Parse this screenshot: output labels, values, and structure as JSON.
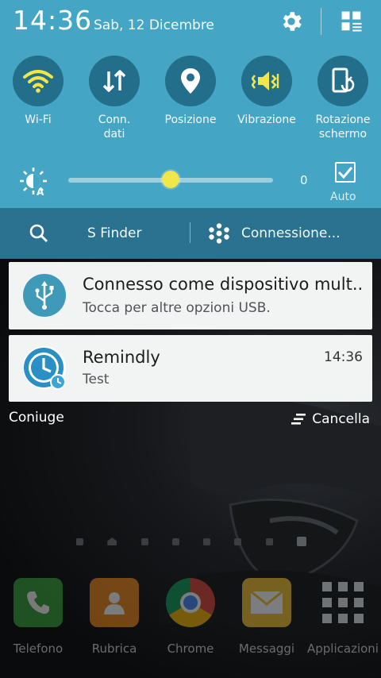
{
  "status": {
    "time": "14:36",
    "date": "Sab, 12 Dicembre"
  },
  "quick_toggles": [
    {
      "label": "Wi-Fi",
      "icon": "wifi-icon"
    },
    {
      "label": "Conn.\ndati",
      "icon": "mobile-data-icon"
    },
    {
      "label": "Posizione",
      "icon": "location-icon"
    },
    {
      "label": "Vibrazione",
      "icon": "vibration-icon"
    },
    {
      "label": "Rotazione\nschermo",
      "icon": "screen-rotation-icon"
    }
  ],
  "brightness": {
    "value": "0",
    "level": 0.5,
    "auto_label": "Auto",
    "auto_checked": true
  },
  "search_bar": {
    "s_finder": "S Finder",
    "connection": "Connessione..."
  },
  "notifications": [
    {
      "title": "Connesso come dispositivo mult..",
      "subtitle": "Tocca per altre opzioni USB.",
      "icon": "usb-icon",
      "time": ""
    },
    {
      "title": "Remindly",
      "subtitle": "Test",
      "icon": "clock-icon",
      "time": "14:36"
    }
  ],
  "actions": {
    "left": "Coniuge",
    "clear": "Cancella"
  },
  "dock": [
    {
      "label": "Telefono",
      "icon": "phone-icon"
    },
    {
      "label": "Rubrica",
      "icon": "contacts-icon"
    },
    {
      "label": "Chrome",
      "icon": "chrome-icon"
    },
    {
      "label": "Messaggi",
      "icon": "messages-icon"
    },
    {
      "label": "Applicazioni",
      "icon": "apps-grid-icon"
    }
  ],
  "colors": {
    "panel": "#45a5c4",
    "toggle_bg": "#236f8b",
    "toggle_active": "#f1e64a",
    "search_bar": "#2a7290"
  }
}
